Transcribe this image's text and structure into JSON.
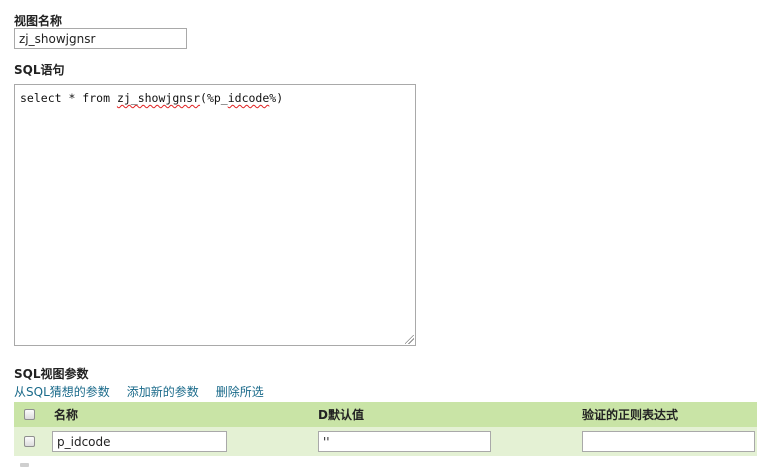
{
  "view_name": {
    "label": "视图名称",
    "value": "zj_showjgnsr"
  },
  "sql": {
    "label": "SQL语句",
    "prefix": "select * from ",
    "misspelled_1": "zj_showjgnsr",
    "middle": "(%p_",
    "misspelled_2": "idcode",
    "suffix": "%)"
  },
  "params": {
    "label": "SQL视图参数",
    "links": [
      "从SQL猜想的参数",
      "添加新的参数",
      "删除所选"
    ],
    "columns": {
      "name": "名称",
      "default": "D默认值",
      "regex": "验证的正则表达式"
    },
    "rows": [
      {
        "name": "p_idcode",
        "default": "''",
        "regex": "",
        "checked": false
      }
    ]
  },
  "colors": {
    "header_bg": "#c9e4a6",
    "row_bg": "#e4f1d4",
    "link": "#1a6a8a"
  }
}
